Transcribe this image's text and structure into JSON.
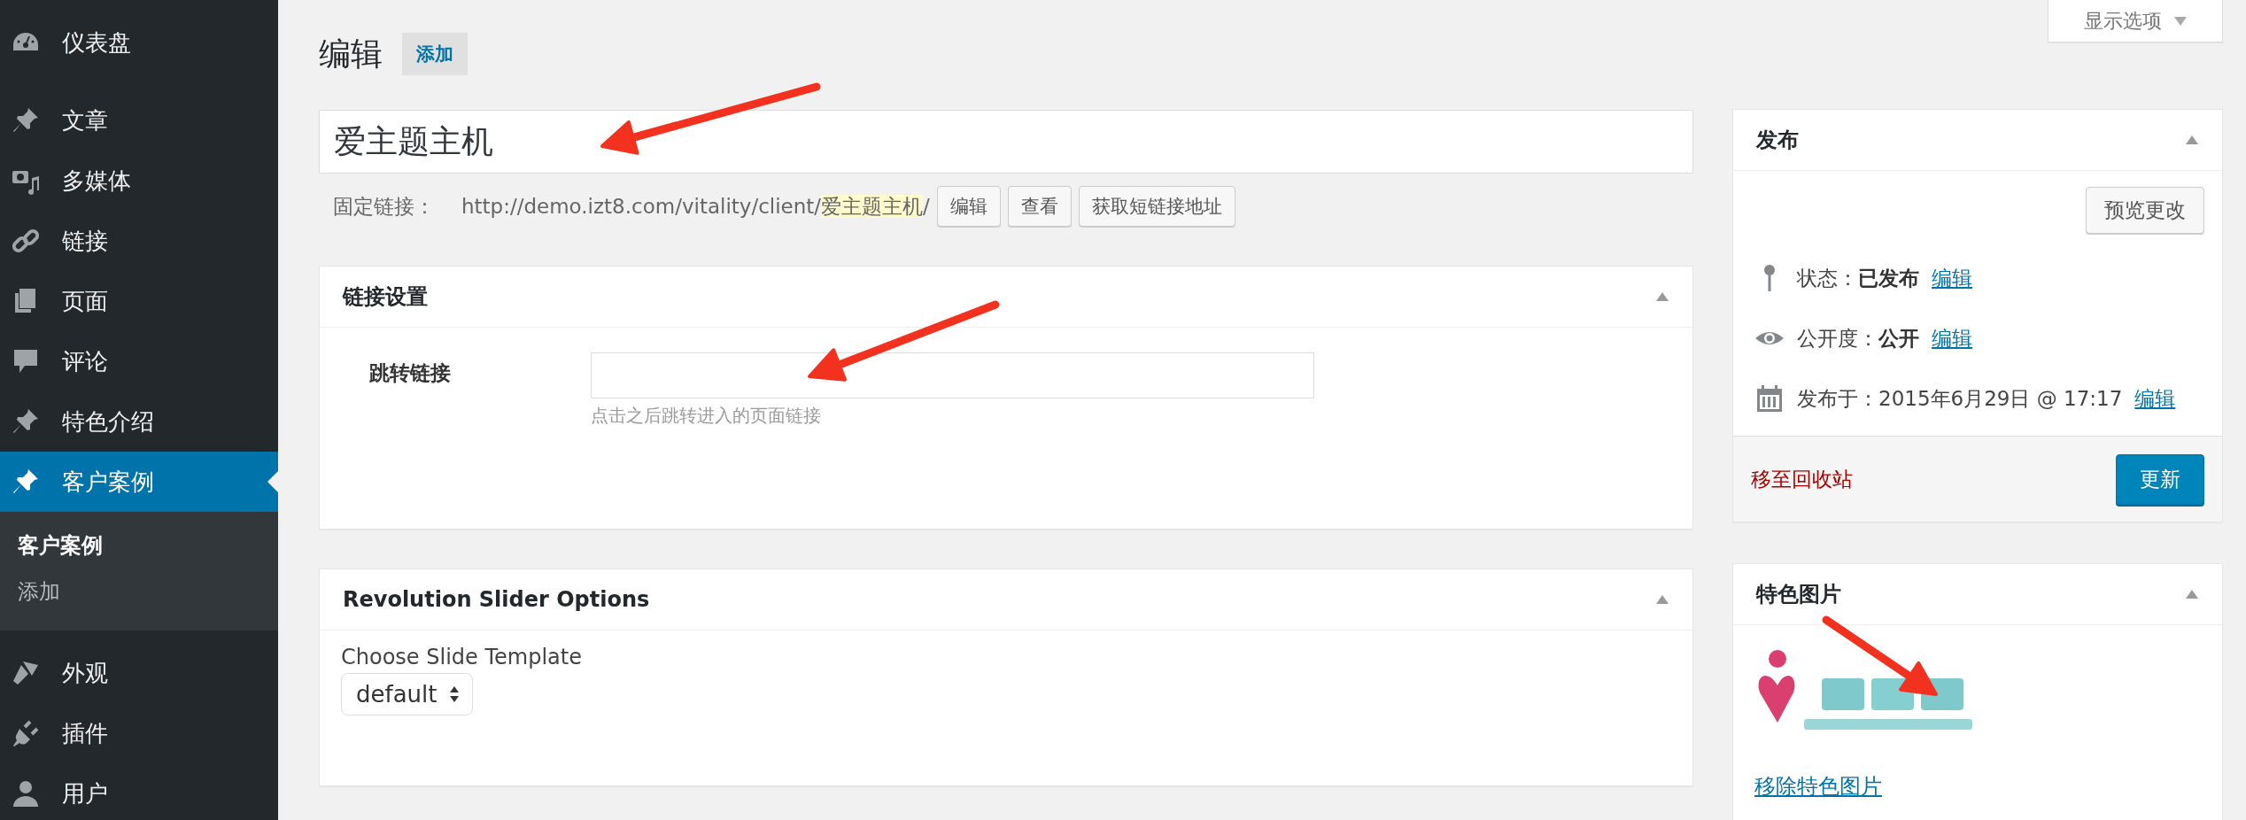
{
  "sidebar": {
    "groups": [
      {
        "items": [
          {
            "label": "仪表盘",
            "selected": false
          }
        ]
      },
      {
        "items": [
          {
            "label": "文章",
            "selected": false
          },
          {
            "label": "多媒体",
            "selected": false
          },
          {
            "label": "链接",
            "selected": false
          },
          {
            "label": "页面",
            "selected": false
          },
          {
            "label": "评论",
            "selected": false
          },
          {
            "label": "特色介绍",
            "selected": false
          },
          {
            "label": "客户案例",
            "selected": true,
            "submenu": [
              {
                "label": "客户案例",
                "selected": true
              },
              {
                "label": "添加",
                "selected": false
              }
            ]
          },
          {
            "label": "外观",
            "selected": false
          },
          {
            "label": "插件",
            "selected": false
          },
          {
            "label": "用户",
            "selected": false
          }
        ]
      }
    ]
  },
  "screen_options_button": "显示选项",
  "heading": {
    "title": "编辑",
    "add_button": "添加"
  },
  "title_field": {
    "value": "爱主题主机"
  },
  "permalink": {
    "label": "固定链接：",
    "url_prefix": "http://demo.izt8.com/vitality/client/",
    "slug": "爱主题主机",
    "suffix": "/",
    "buttons": [
      "编辑",
      "查看",
      "获取短链接地址"
    ]
  },
  "link_settings": {
    "title": "链接设置",
    "expanded": true,
    "field_label": "跳转链接",
    "hint": "点击之后跳转进入的页面链接"
  },
  "slider_options": {
    "title": "Revolution Slider Options",
    "expanded": true,
    "label": "Choose Slide Template",
    "select_value": "default"
  },
  "publish": {
    "title": "发布",
    "expanded": true,
    "preview_button": "预览更改",
    "rows": [
      {
        "label": "状态：",
        "value": "已发布",
        "emphasis": true,
        "link": "编辑"
      },
      {
        "label": "公开度：",
        "value": "公开",
        "emphasis": true,
        "link": "编辑"
      },
      {
        "label": "发布于：",
        "value": "2015年6月29日 @ 17:17",
        "emphasis": false,
        "link": "编辑"
      }
    ],
    "trash_link": "移至回收站",
    "update_button": "更新"
  },
  "featured_image": {
    "title": "特色图片",
    "expanded": true,
    "remove_link": "移除特色图片"
  }
}
